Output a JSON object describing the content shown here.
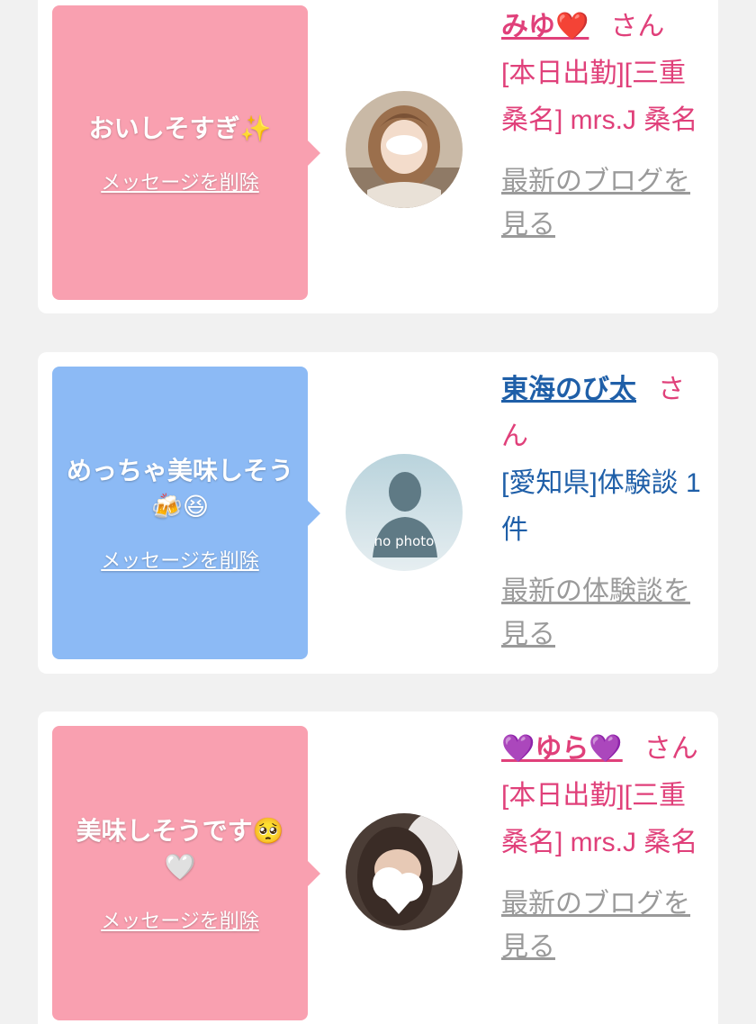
{
  "messages": [
    {
      "text": "おいしそすぎ✨",
      "delete_label": "メッセージを削除",
      "name": "みゆ❤️",
      "honorific": "さん",
      "detail": "[本日出勤][三重 桑名] mrs.J 桑名",
      "latest_link": "最新のブログを見る",
      "color": "#f9a0b0"
    },
    {
      "text": "めっちゃ美味しそう🍻😆",
      "delete_label": "メッセージを削除",
      "name": "東海のび太",
      "honorific": "さん",
      "detail": "[愛知県]体験談 1件",
      "latest_link": "最新の体験談を見る",
      "avatar_text": "no photo",
      "color": "#8cbaf5"
    },
    {
      "text": "美味しそうです🥺🤍",
      "delete_label": "メッセージを削除",
      "name": "💜ゆら💜",
      "honorific": "さん",
      "detail": "[本日出勤][三重 桑名] mrs.J 桑名",
      "latest_link": "最新のブログを見る",
      "color": "#f9a0b0"
    }
  ]
}
